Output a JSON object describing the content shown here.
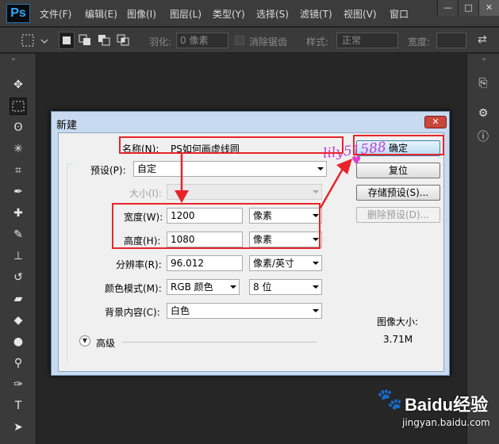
{
  "app": {
    "logo": "Ps"
  },
  "menubar": {
    "items": [
      "文件(F)",
      "编辑(E)",
      "图像(I)",
      "图层(L)",
      "类型(Y)",
      "选择(S)",
      "滤镜(T)",
      "视图(V)",
      "窗口"
    ],
    "window_buttons": {
      "minimize": "—",
      "maximize": "□",
      "close": "✕"
    }
  },
  "options_bar": {
    "feather_label": "羽化:",
    "feather_value": "0 像素",
    "antialias_label": "消除锯齿",
    "style_label": "样式:",
    "style_value": "正常",
    "width_label": "宽度:"
  },
  "tools": {
    "icons": [
      "move-icon",
      "marquee-icon",
      "lasso-icon",
      "magic-wand-icon",
      "crop-icon",
      "eyedropper-icon",
      "healing-brush-icon",
      "brush-icon",
      "stamp-icon",
      "history-brush-icon",
      "eraser-icon",
      "paint-bucket-icon",
      "blur-icon",
      "dodge-icon",
      "pen-icon",
      "type-icon",
      "path-select-icon"
    ],
    "type_glyph": "T"
  },
  "dialog": {
    "title": "新建",
    "close": "✕",
    "name_label": "名称(N):",
    "name_value": "PS如何画虚线圆",
    "preset_label": "预设(P):",
    "preset_value": "自定",
    "size_label": "大小(I):",
    "width_label": "宽度(W):",
    "width_value": "1200",
    "width_unit": "像素",
    "height_label": "高度(H):",
    "height_value": "1080",
    "height_unit": "像素",
    "resolution_label": "分辨率(R):",
    "resolution_value": "96.012",
    "resolution_unit": "像素/英寸",
    "color_mode_label": "颜色模式(M):",
    "color_mode_value": "RGB 颜色",
    "bit_depth_value": "8 位",
    "background_label": "背景内容(C):",
    "background_value": "白色",
    "advanced_label": "高级",
    "ok_button": "确定",
    "reset_button": "复位",
    "save_preset_button": "存储预设(S)...",
    "delete_preset_button": "删除预设(D)...",
    "image_size_label": "图像大小:",
    "image_size_value": "3.71M"
  },
  "watermark": "lily51588",
  "brand": {
    "name": "Baidu经验",
    "url": "jingyan.baidu.com"
  },
  "colors": {
    "annotation_red": "#e8242a",
    "accent_blue": "#1a6fb5"
  }
}
